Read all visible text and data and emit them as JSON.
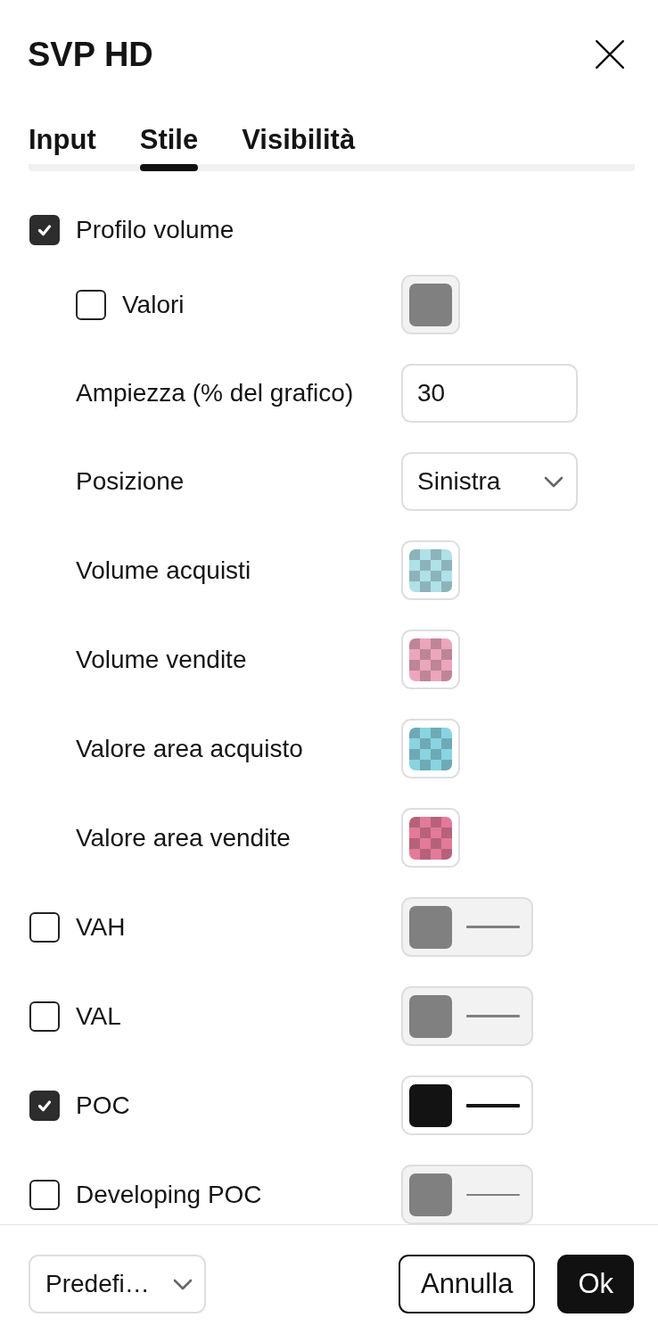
{
  "dialog": {
    "title": "SVP HD"
  },
  "tabs": [
    {
      "label": "Input",
      "selected": false
    },
    {
      "label": "Stile",
      "selected": true
    },
    {
      "label": "Visibilità",
      "selected": false
    }
  ],
  "settings": [
    {
      "kind": "checkbox",
      "label": "Profilo volume",
      "checked": true,
      "children": [
        {
          "kind": "checkbox-color",
          "label": "Valori",
          "checked": false,
          "color": "#808080"
        },
        {
          "kind": "number",
          "label": "Ampiezza (% del grafico)",
          "value": "30"
        },
        {
          "kind": "select",
          "label": "Posizione",
          "value": "Sinistra"
        },
        {
          "kind": "color",
          "label": "Volume acquisti",
          "color": "#b0e0e8",
          "transparent": true
        },
        {
          "kind": "color",
          "label": "Volume vendite",
          "color": "#eca6bb",
          "transparent": true
        },
        {
          "kind": "color",
          "label": "Valore area acquisto",
          "color": "#8ad4e2",
          "transparent": true
        },
        {
          "kind": "color",
          "label": "Valore area vendite",
          "color": "#e47a99",
          "transparent": true
        }
      ]
    },
    {
      "kind": "medium-line",
      "label": "VAH",
      "checked": false,
      "color": "#808080"
    },
    {
      "kind": "medium-line",
      "label": "VAL",
      "checked": false,
      "color": "#808080"
    },
    {
      "kind": "thick-line",
      "label": "POC",
      "checked": true,
      "color": "#131313"
    },
    {
      "kind": "thin-line",
      "label": "Developing POC",
      "checked": false,
      "color": "#808080"
    }
  ],
  "footer": {
    "preset": "Predefi…",
    "buttons": [
      {
        "label": "Annulla",
        "kind": "secondary"
      },
      {
        "label": "Ok",
        "kind": "primary"
      }
    ]
  }
}
